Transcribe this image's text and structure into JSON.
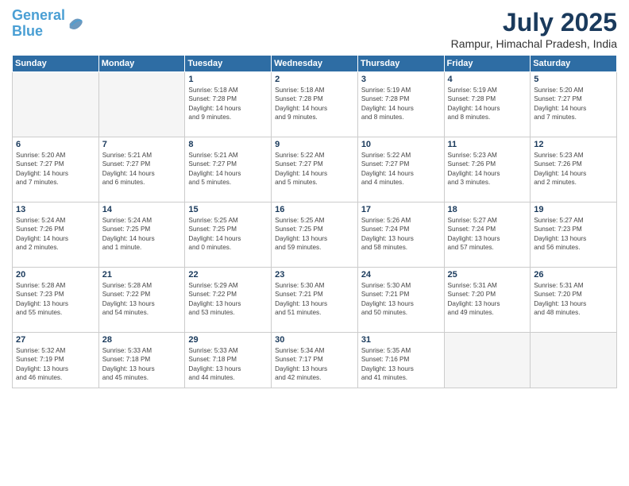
{
  "logo": {
    "line1": "General",
    "line2": "Blue"
  },
  "title": "July 2025",
  "location": "Rampur, Himachal Pradesh, India",
  "weekdays": [
    "Sunday",
    "Monday",
    "Tuesday",
    "Wednesday",
    "Thursday",
    "Friday",
    "Saturday"
  ],
  "weeks": [
    [
      {
        "day": "",
        "info": ""
      },
      {
        "day": "",
        "info": ""
      },
      {
        "day": "1",
        "info": "Sunrise: 5:18 AM\nSunset: 7:28 PM\nDaylight: 14 hours\nand 9 minutes."
      },
      {
        "day": "2",
        "info": "Sunrise: 5:18 AM\nSunset: 7:28 PM\nDaylight: 14 hours\nand 9 minutes."
      },
      {
        "day": "3",
        "info": "Sunrise: 5:19 AM\nSunset: 7:28 PM\nDaylight: 14 hours\nand 8 minutes."
      },
      {
        "day": "4",
        "info": "Sunrise: 5:19 AM\nSunset: 7:28 PM\nDaylight: 14 hours\nand 8 minutes."
      },
      {
        "day": "5",
        "info": "Sunrise: 5:20 AM\nSunset: 7:27 PM\nDaylight: 14 hours\nand 7 minutes."
      }
    ],
    [
      {
        "day": "6",
        "info": "Sunrise: 5:20 AM\nSunset: 7:27 PM\nDaylight: 14 hours\nand 7 minutes."
      },
      {
        "day": "7",
        "info": "Sunrise: 5:21 AM\nSunset: 7:27 PM\nDaylight: 14 hours\nand 6 minutes."
      },
      {
        "day": "8",
        "info": "Sunrise: 5:21 AM\nSunset: 7:27 PM\nDaylight: 14 hours\nand 5 minutes."
      },
      {
        "day": "9",
        "info": "Sunrise: 5:22 AM\nSunset: 7:27 PM\nDaylight: 14 hours\nand 5 minutes."
      },
      {
        "day": "10",
        "info": "Sunrise: 5:22 AM\nSunset: 7:27 PM\nDaylight: 14 hours\nand 4 minutes."
      },
      {
        "day": "11",
        "info": "Sunrise: 5:23 AM\nSunset: 7:26 PM\nDaylight: 14 hours\nand 3 minutes."
      },
      {
        "day": "12",
        "info": "Sunrise: 5:23 AM\nSunset: 7:26 PM\nDaylight: 14 hours\nand 2 minutes."
      }
    ],
    [
      {
        "day": "13",
        "info": "Sunrise: 5:24 AM\nSunset: 7:26 PM\nDaylight: 14 hours\nand 2 minutes."
      },
      {
        "day": "14",
        "info": "Sunrise: 5:24 AM\nSunset: 7:25 PM\nDaylight: 14 hours\nand 1 minute."
      },
      {
        "day": "15",
        "info": "Sunrise: 5:25 AM\nSunset: 7:25 PM\nDaylight: 14 hours\nand 0 minutes."
      },
      {
        "day": "16",
        "info": "Sunrise: 5:25 AM\nSunset: 7:25 PM\nDaylight: 13 hours\nand 59 minutes."
      },
      {
        "day": "17",
        "info": "Sunrise: 5:26 AM\nSunset: 7:24 PM\nDaylight: 13 hours\nand 58 minutes."
      },
      {
        "day": "18",
        "info": "Sunrise: 5:27 AM\nSunset: 7:24 PM\nDaylight: 13 hours\nand 57 minutes."
      },
      {
        "day": "19",
        "info": "Sunrise: 5:27 AM\nSunset: 7:23 PM\nDaylight: 13 hours\nand 56 minutes."
      }
    ],
    [
      {
        "day": "20",
        "info": "Sunrise: 5:28 AM\nSunset: 7:23 PM\nDaylight: 13 hours\nand 55 minutes."
      },
      {
        "day": "21",
        "info": "Sunrise: 5:28 AM\nSunset: 7:22 PM\nDaylight: 13 hours\nand 54 minutes."
      },
      {
        "day": "22",
        "info": "Sunrise: 5:29 AM\nSunset: 7:22 PM\nDaylight: 13 hours\nand 53 minutes."
      },
      {
        "day": "23",
        "info": "Sunrise: 5:30 AM\nSunset: 7:21 PM\nDaylight: 13 hours\nand 51 minutes."
      },
      {
        "day": "24",
        "info": "Sunrise: 5:30 AM\nSunset: 7:21 PM\nDaylight: 13 hours\nand 50 minutes."
      },
      {
        "day": "25",
        "info": "Sunrise: 5:31 AM\nSunset: 7:20 PM\nDaylight: 13 hours\nand 49 minutes."
      },
      {
        "day": "26",
        "info": "Sunrise: 5:31 AM\nSunset: 7:20 PM\nDaylight: 13 hours\nand 48 minutes."
      }
    ],
    [
      {
        "day": "27",
        "info": "Sunrise: 5:32 AM\nSunset: 7:19 PM\nDaylight: 13 hours\nand 46 minutes."
      },
      {
        "day": "28",
        "info": "Sunrise: 5:33 AM\nSunset: 7:18 PM\nDaylight: 13 hours\nand 45 minutes."
      },
      {
        "day": "29",
        "info": "Sunrise: 5:33 AM\nSunset: 7:18 PM\nDaylight: 13 hours\nand 44 minutes."
      },
      {
        "day": "30",
        "info": "Sunrise: 5:34 AM\nSunset: 7:17 PM\nDaylight: 13 hours\nand 42 minutes."
      },
      {
        "day": "31",
        "info": "Sunrise: 5:35 AM\nSunset: 7:16 PM\nDaylight: 13 hours\nand 41 minutes."
      },
      {
        "day": "",
        "info": ""
      },
      {
        "day": "",
        "info": ""
      }
    ]
  ]
}
